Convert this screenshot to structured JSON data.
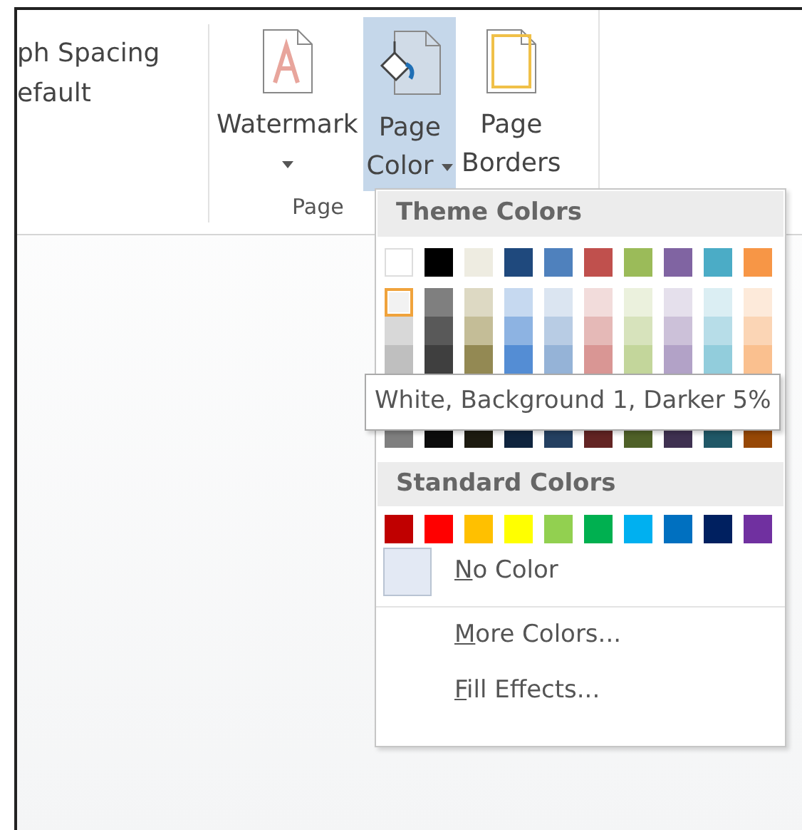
{
  "ribbon": {
    "left_group": {
      "lines": [
        "ph Spacing",
        "efault"
      ]
    },
    "buttons": [
      {
        "kind": "watermark",
        "lines": [
          "Watermark"
        ],
        "dropdown": true,
        "selected": false
      },
      {
        "kind": "page_color",
        "lines": [
          "Page",
          "Color"
        ],
        "dropdown": true,
        "selected": true
      },
      {
        "kind": "page_borders",
        "lines": [
          "Page",
          "Borders"
        ],
        "dropdown": false,
        "selected": false
      }
    ],
    "group_label": "Page"
  },
  "menu": {
    "theme_header": "Theme Colors",
    "theme_top": [
      {
        "color": "#ffffff"
      },
      {
        "color": "#000000"
      },
      {
        "color": "#eeece1"
      },
      {
        "color": "#1f497d"
      },
      {
        "color": "#4f81bd"
      },
      {
        "color": "#c0504d"
      },
      {
        "color": "#9bbb59"
      },
      {
        "color": "#8064a2"
      },
      {
        "color": "#4bacc6"
      },
      {
        "color": "#f79646"
      }
    ],
    "theme_shades": [
      [
        {
          "color": "#f2f2f2",
          "selected": true
        },
        {
          "color": "#7f7f7f",
          "selected": false
        },
        {
          "color": "#ddd9c3",
          "selected": false
        },
        {
          "color": "#c6d9f0",
          "selected": false
        },
        {
          "color": "#dbe5f1",
          "selected": false
        },
        {
          "color": "#f2dcdb",
          "selected": false
        },
        {
          "color": "#ebf1dd",
          "selected": false
        },
        {
          "color": "#e5e0ec",
          "selected": false
        },
        {
          "color": "#dbeef3",
          "selected": false
        },
        {
          "color": "#fdeada",
          "selected": false
        }
      ],
      [
        {
          "color": "#d8d8d8",
          "selected": false
        },
        {
          "color": "#595959",
          "selected": false
        },
        {
          "color": "#c4bd97",
          "selected": false
        },
        {
          "color": "#8db3e2",
          "selected": false
        },
        {
          "color": "#b8cce4",
          "selected": false
        },
        {
          "color": "#e5b9b7",
          "selected": false
        },
        {
          "color": "#d7e3bc",
          "selected": false
        },
        {
          "color": "#ccc1d9",
          "selected": false
        },
        {
          "color": "#b7dde8",
          "selected": false
        },
        {
          "color": "#fbd5b5",
          "selected": false
        }
      ],
      [
        {
          "color": "#bfbfbf",
          "selected": false
        },
        {
          "color": "#3f3f3f",
          "selected": false
        },
        {
          "color": "#938953",
          "selected": false
        },
        {
          "color": "#548dd4",
          "selected": false
        },
        {
          "color": "#95b3d7",
          "selected": false
        },
        {
          "color": "#d99694",
          "selected": false
        },
        {
          "color": "#c3d69b",
          "selected": false
        },
        {
          "color": "#b2a2c7",
          "selected": false
        },
        {
          "color": "#92cddc",
          "selected": false
        },
        {
          "color": "#fac08f",
          "selected": false
        }
      ],
      [
        {
          "color": "#7f7f7f",
          "selected": false
        },
        {
          "color": "#0c0c0c",
          "selected": false
        },
        {
          "color": "#1d1b10",
          "selected": false
        },
        {
          "color": "#0f243e",
          "selected": false
        },
        {
          "color": "#244061",
          "selected": false
        },
        {
          "color": "#632423",
          "selected": false
        },
        {
          "color": "#4f6128",
          "selected": false
        },
        {
          "color": "#3f3151",
          "selected": false
        },
        {
          "color": "#205867",
          "selected": false
        },
        {
          "color": "#974806",
          "selected": false
        }
      ]
    ],
    "standard_header": "Standard Colors",
    "standard": [
      {
        "color": "#c00000"
      },
      {
        "color": "#ff0000"
      },
      {
        "color": "#ffc000"
      },
      {
        "color": "#ffff00"
      },
      {
        "color": "#92d050"
      },
      {
        "color": "#00b050"
      },
      {
        "color": "#00b0f0"
      },
      {
        "color": "#0070c0"
      },
      {
        "color": "#002060"
      },
      {
        "color": "#7030a0"
      }
    ],
    "items": [
      {
        "kind": "swatch",
        "mnemonic": "N",
        "rest": "o Color"
      },
      {
        "kind": "plain",
        "mnemonic": "M",
        "rest": "ore Colors..."
      },
      {
        "kind": "plain",
        "mnemonic": "F",
        "rest": "ill Effects..."
      }
    ]
  },
  "tooltip": "White, Background 1, Darker 5%"
}
